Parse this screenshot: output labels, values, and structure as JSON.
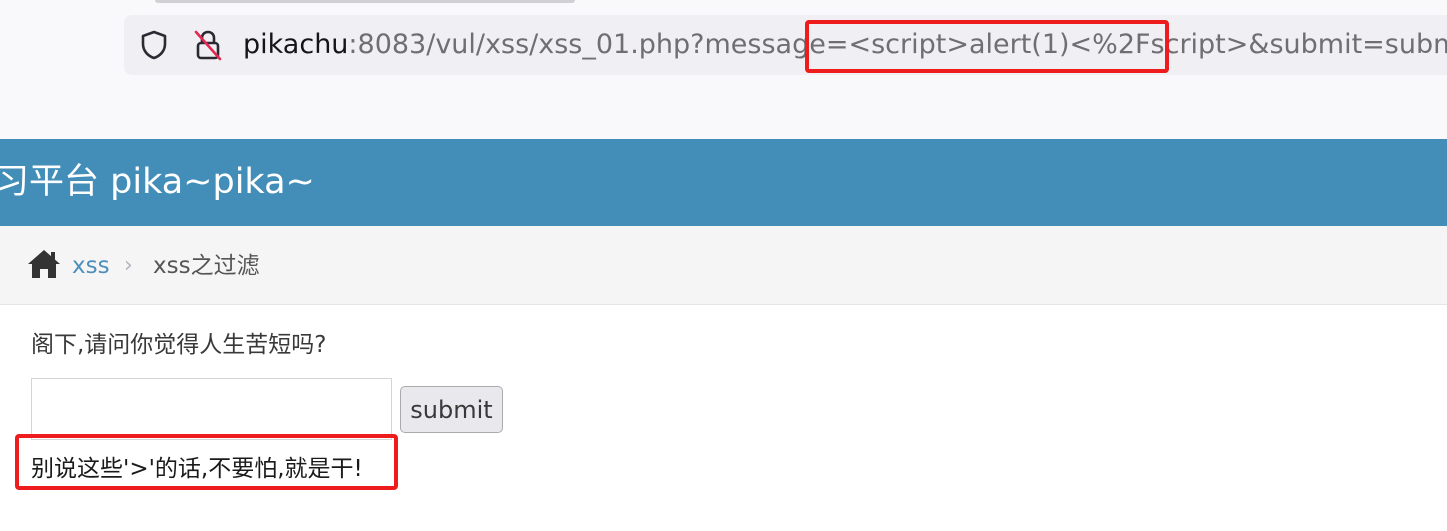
{
  "browser": {
    "url_host": "pikachu",
    "url_before": ":8083/vul/xss/xss_01.php?message=",
    "url_payload": "<script>alert(1)<%2Fscript>",
    "url_after": "&submit=submit"
  },
  "header": {
    "title": "习平台 pika~pika~"
  },
  "breadcrumb": {
    "home_icon": "home-icon",
    "link": "xss",
    "separator": "›",
    "current": "xss之过滤"
  },
  "content": {
    "question": "阁下,请问你觉得人生苦短吗?",
    "input_value": "",
    "submit_label": "submit",
    "result": "别说这些'>'的话,不要怕,就是干!"
  },
  "colors": {
    "header": "#438eb9",
    "link": "#4c8fbd",
    "highlight": "#ee1c1c"
  }
}
